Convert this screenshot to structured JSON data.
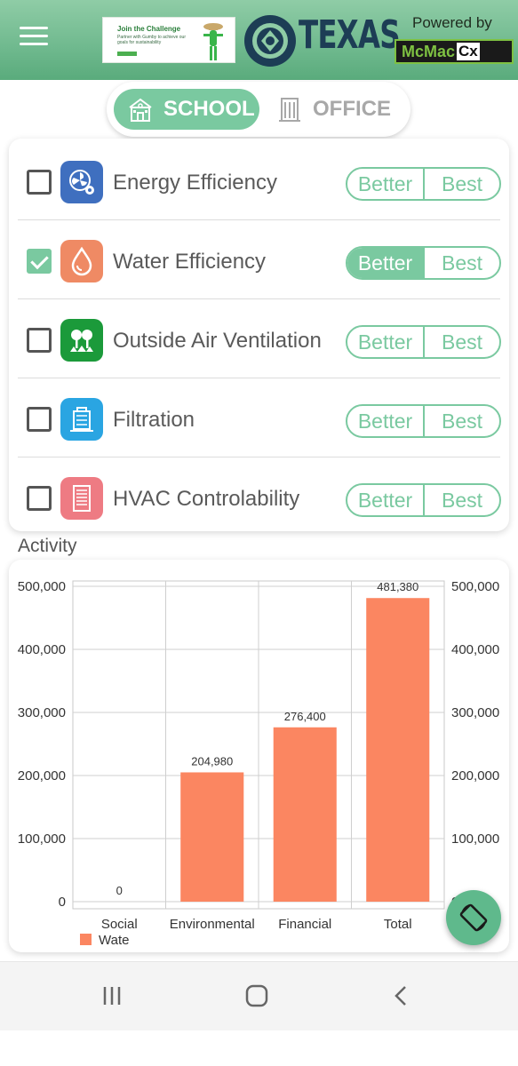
{
  "header": {
    "ad": {
      "title": "Join the Challenge",
      "subtitle": "Partner with Gumby to achieve our goals for sustainability"
    },
    "logo_text": "TEXAS",
    "powered_by": "Powered by",
    "brand_main": "McMac",
    "brand_suffix": "Cx"
  },
  "building_types": {
    "school": "SCHOOL",
    "office": "OFFICE",
    "selected": "school"
  },
  "categories": [
    {
      "label": "Energy Efficiency",
      "checked": false,
      "icon": "fan-gear-icon",
      "icon_color": "#3f6fbf",
      "better": "Better",
      "best": "Best",
      "selected": null
    },
    {
      "label": "Water Efficiency",
      "checked": true,
      "icon": "water-drop-icon",
      "icon_color": "#ef8a64",
      "better": "Better",
      "best": "Best",
      "selected": "better"
    },
    {
      "label": "Outside Air Ventilation",
      "checked": false,
      "icon": "trees-icon",
      "icon_color": "#1b9a3a",
      "better": "Better",
      "best": "Best",
      "selected": null
    },
    {
      "label": "Filtration",
      "checked": false,
      "icon": "filter-building-icon",
      "icon_color": "#2aa5e2",
      "better": "Better",
      "best": "Best",
      "selected": null
    },
    {
      "label": "HVAC Controlability",
      "checked": false,
      "icon": "hvac-panel-icon",
      "icon_color": "#ee7b83",
      "better": "Better",
      "best": "Best",
      "selected": null
    }
  ],
  "activity_label": "Activity",
  "chart_data": {
    "type": "bar",
    "categories": [
      "Social",
      "Environmental",
      "Financial",
      "Total"
    ],
    "series": [
      {
        "name": "Wate",
        "color": "#fb8661",
        "values": [
          0,
          204980,
          276400,
          481380
        ]
      }
    ],
    "value_labels": [
      "0",
      "204,980",
      "276,400",
      "481,380"
    ],
    "y_ticks": [
      "500,000",
      "400,000",
      "300,000",
      "200,000",
      "100,000",
      "0"
    ],
    "ylim": [
      0,
      500000
    ],
    "grid": true,
    "legend_position": "bottom-left"
  },
  "colors": {
    "accent": "#7ac9a0",
    "bar": "#fb8661"
  }
}
